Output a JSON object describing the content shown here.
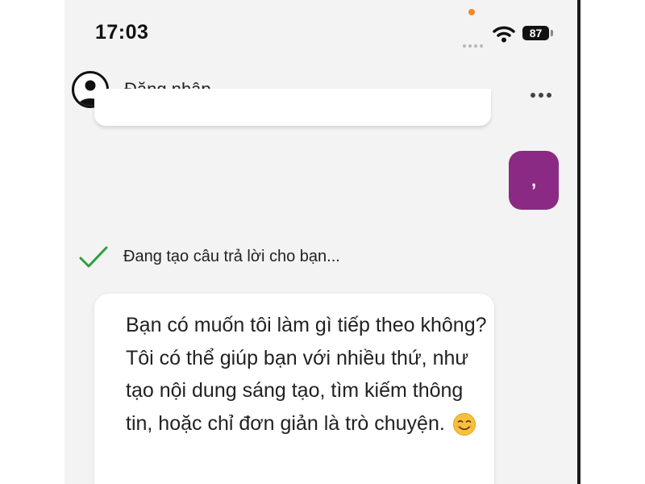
{
  "status_bar": {
    "time": "17:03",
    "battery": "87",
    "icons": [
      "signal-dots-icon",
      "wifi-icon",
      "battery-icon"
    ]
  },
  "header": {
    "login_label": "Đăng nhập",
    "avatar_icon": "user-avatar-icon",
    "more_icon": "more-horizontal-icon"
  },
  "chat": {
    "user_message": ",",
    "status": {
      "icon": "checkmark-icon",
      "text": "Đang tạo câu trả lời cho bạn..."
    },
    "response": {
      "text": "Bạn có muốn tôi làm gì tiếp theo không? Tôi có thể giúp bạn với nhiều thứ, như tạo nội dung sáng tạo, tìm kiếm thông tin, hoặc chỉ đơn giản là trò chuyện.",
      "emoji": "smiling-face-icon"
    }
  },
  "colors": {
    "user_bubble": "#8b2a84",
    "check": "#2e9e3e",
    "indicator_dot": "#f2892a",
    "background": "#f3f3f3"
  }
}
